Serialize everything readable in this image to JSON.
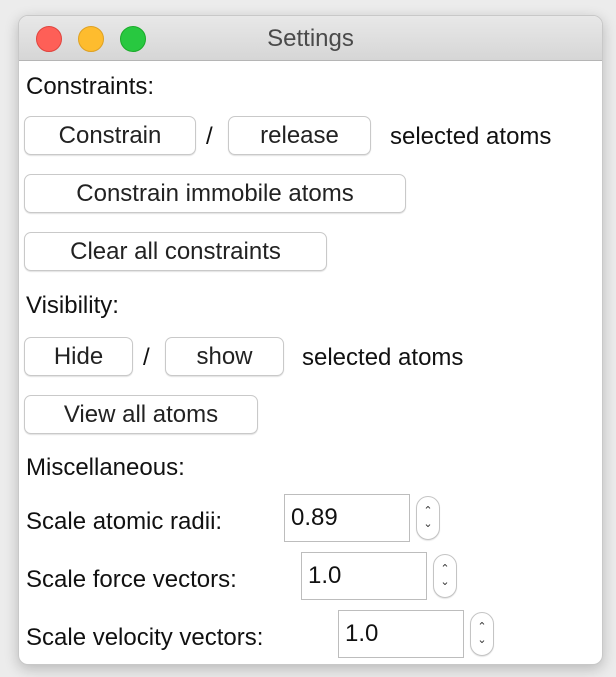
{
  "window": {
    "title": "Settings"
  },
  "constraints": {
    "heading": "Constraints:",
    "constrain_label": "Constrain",
    "separator": "/",
    "release_label": "release",
    "suffix": "selected atoms",
    "immobile_label": "Constrain immobile atoms",
    "clear_label": "Clear all constraints"
  },
  "visibility": {
    "heading": "Visibility:",
    "hide_label": "Hide",
    "separator": "/",
    "show_label": "show",
    "suffix": "selected atoms",
    "view_all_label": "View all atoms"
  },
  "misc": {
    "heading": "Miscellaneous:",
    "radii": {
      "label": "Scale atomic radii:",
      "value": "0.89"
    },
    "force": {
      "label": "Scale force vectors:",
      "value": "1.0"
    },
    "velocity": {
      "label": "Scale velocity vectors:",
      "value": "1.0"
    },
    "stepper_up": "⌃",
    "stepper_down": "⌄"
  },
  "colors": {
    "close": "#fe5f57",
    "minimize": "#febc2e",
    "zoom": "#28c840"
  }
}
